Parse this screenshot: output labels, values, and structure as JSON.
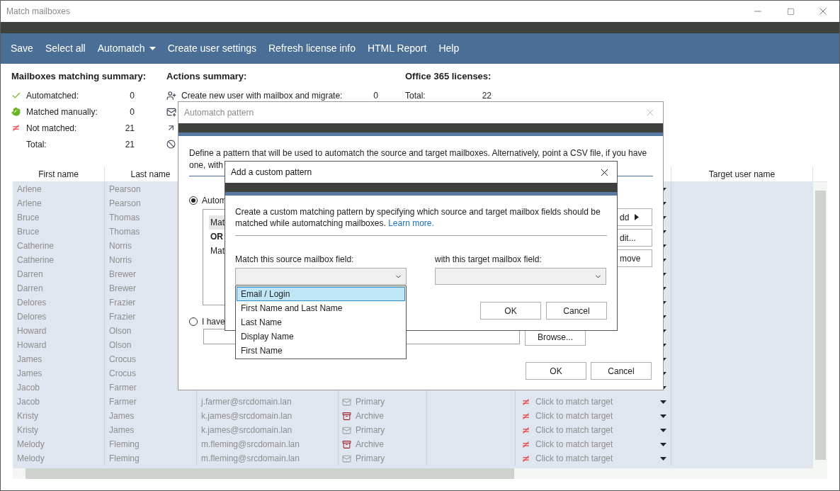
{
  "window": {
    "title": "Match mailboxes"
  },
  "menu": [
    {
      "label": "Save",
      "kind": "item"
    },
    {
      "label": "Select all",
      "kind": "item"
    },
    {
      "label": "Automatch",
      "kind": "dropdown"
    },
    {
      "label": "Create user settings",
      "kind": "item"
    },
    {
      "label": "Refresh license info",
      "kind": "item"
    },
    {
      "label": "HTML Report",
      "kind": "item"
    },
    {
      "label": "Help",
      "kind": "item"
    }
  ],
  "mailboxes_summary": {
    "title": "Mailboxes matching summary:",
    "rows": [
      {
        "kind": "automatched",
        "label": "Automatched:",
        "count": "0"
      },
      {
        "kind": "manual",
        "label": "Matched manually:",
        "count": "0"
      },
      {
        "kind": "unmatched",
        "label": "Not matched:",
        "count": "21"
      },
      {
        "kind": "total",
        "label": "Total:",
        "count": "21"
      }
    ]
  },
  "actions_summary": {
    "title": "Actions summary:",
    "rows": [
      {
        "kind": "user",
        "label": "Create new user with mailbox and migrate:",
        "count": "0"
      },
      {
        "kind": "mailbox"
      },
      {
        "kind": "arrow"
      },
      {
        "kind": "skip"
      }
    ]
  },
  "licenses": {
    "title": "Office 365 licenses:",
    "rows": [
      {
        "label": "Total:",
        "count": "22"
      }
    ]
  },
  "table": {
    "columns": {
      "column_1": "First name",
      "column_2": "Last name",
      "column_7": "Target user name"
    },
    "rows": [
      {
        "first_name": "Arlene",
        "last_name": "Pearson"
      },
      {
        "first_name": "Arlene",
        "last_name": "Pearson"
      },
      {
        "first_name": "Bruce",
        "last_name": "Thomas"
      },
      {
        "first_name": "Bruce",
        "last_name": "Thomas"
      },
      {
        "first_name": "Catherine",
        "last_name": "Norris"
      },
      {
        "first_name": "Catherine",
        "last_name": "Norris"
      },
      {
        "first_name": "Darren",
        "last_name": "Brewer"
      },
      {
        "first_name": "Darren",
        "last_name": "Brewer"
      },
      {
        "first_name": "Delores",
        "last_name": "Frazier"
      },
      {
        "first_name": "Delores",
        "last_name": "Frazier"
      },
      {
        "first_name": "Howard",
        "last_name": "Olson"
      },
      {
        "first_name": "Howard",
        "last_name": "Olson"
      },
      {
        "first_name": "James",
        "last_name": "Crocus"
      },
      {
        "first_name": "James",
        "last_name": "Crocus"
      },
      {
        "first_name": "Jacob",
        "last_name": "Farmer"
      },
      {
        "first_name": "Jacob",
        "last_name": "Farmer",
        "email": "j.farmer@srcdomain.lan",
        "mailbox_type": {
          "kind": "primary",
          "label": "Primary"
        },
        "match": {
          "kind": "unmatched",
          "label": "Click to match target"
        }
      },
      {
        "first_name": "Kristy",
        "last_name": "James",
        "email": "k.james@srcdomain.lan",
        "mailbox_type": {
          "kind": "archive",
          "label": "Archive"
        },
        "match": {
          "kind": "unmatched",
          "label": "Click to match target"
        }
      },
      {
        "first_name": "Kristy",
        "last_name": "James",
        "email": "k.james@srcdomain.lan",
        "mailbox_type": {
          "kind": "primary",
          "label": "Primary"
        },
        "match": {
          "kind": "unmatched",
          "label": "Click to match target"
        }
      },
      {
        "first_name": "Melody",
        "last_name": "Fleming",
        "email": "m.fleming@srcdomain.lan",
        "mailbox_type": {
          "kind": "archive",
          "label": "Archive"
        },
        "match": {
          "kind": "unmatched",
          "label": "Click to match target"
        }
      },
      {
        "first_name": "Melody",
        "last_name": "Fleming",
        "email": "m.fleming@srcdomain.lan",
        "mailbox_type": {
          "kind": "primary",
          "label": "Primary"
        },
        "match": {
          "kind": "unmatched",
          "label": "Click to match target"
        }
      }
    ]
  },
  "automatch_dialog": {
    "title": "Automatch pattern",
    "description": [
      "Define a pattern that will be used to automatch the source and target mailboxes. Alternatively, point a CSV file, if you have",
      "one, with"
    ],
    "options": [
      {
        "label": "Autom",
        "selected": true
      },
      {
        "label": "I have",
        "selected": false
      }
    ],
    "patterns": [
      {
        "label": "Mat",
        "kind": "pattern",
        "selected": true
      },
      {
        "label": "OR",
        "kind": "operator",
        "selected": false
      },
      {
        "label": "Mat",
        "kind": "pattern",
        "selected": false
      }
    ],
    "side_buttons": [
      {
        "label": "dd",
        "kind": "menu"
      },
      {
        "label": "dit...",
        "kind": "plain"
      },
      {
        "label": "move",
        "kind": "plain"
      }
    ],
    "browse_button": "Browse...",
    "buttons": [
      "OK",
      "Cancel"
    ]
  },
  "custom_pattern_dialog": {
    "title": "Add a custom pattern",
    "description": "Create a custom matching pattern by specifying which source and target mailbox fields should be matched while automatching mailboxes.",
    "link": "Learn more.",
    "source_label": "Match this source mailbox field:",
    "target_label": "with this target mailbox field:",
    "source_options": [
      {
        "label": "Email / Login",
        "selected": true
      },
      {
        "label": "First Name and Last Name",
        "selected": false
      },
      {
        "label": "Last Name",
        "selected": false
      },
      {
        "label": "Display Name",
        "selected": false
      },
      {
        "label": "First Name",
        "selected": false
      }
    ],
    "buttons": [
      "OK",
      "Cancel"
    ]
  }
}
